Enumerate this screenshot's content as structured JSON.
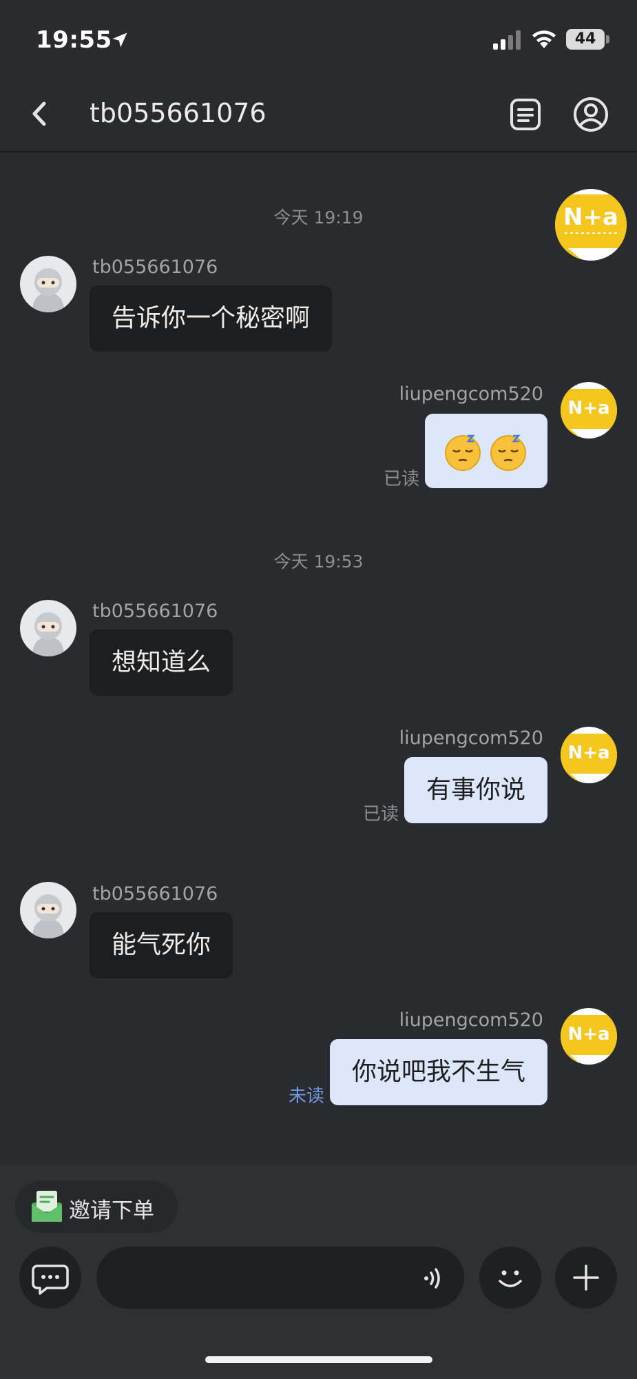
{
  "status_bar": {
    "time": "19:55",
    "battery": "44"
  },
  "header": {
    "title": "tb055661076"
  },
  "float_avatar": {
    "logo_text": "N+a"
  },
  "messages": [
    {
      "timestamp": "今天 19:19"
    },
    {
      "sender": "tb055661076",
      "text": "告诉你一个秘密啊"
    },
    {
      "sender": "liupengcom520",
      "emoji": "😌😌",
      "status": "已读"
    },
    {
      "timestamp": "今天 19:53"
    },
    {
      "sender": "tb055661076",
      "text": "想知道么"
    },
    {
      "sender": "liupengcom520",
      "text": "有事你说",
      "status": "已读"
    },
    {
      "sender": "tb055661076",
      "text": "能气死你"
    },
    {
      "sender": "liupengcom520",
      "text": "你说吧我不生气",
      "status": "未读"
    }
  ],
  "bottom_bar": {
    "invite_label": "邀请下单",
    "input_placeholder": ""
  },
  "colors": {
    "background": "#2a2b2e",
    "incoming_bubble": "#1d1e20",
    "outgoing_bubble": "#dde7fc",
    "unread_status": "#6f9ae0",
    "logo_yellow": "#f5c61d"
  },
  "icons": {
    "back": "chevron-left-icon",
    "note": "document-icon",
    "profile": "user-icon",
    "chat": "chat-bubble-icon",
    "voice": "voice-wave-icon",
    "emoji": "smile-icon",
    "plus": "plus-icon",
    "invite": "order-envelope-icon"
  }
}
